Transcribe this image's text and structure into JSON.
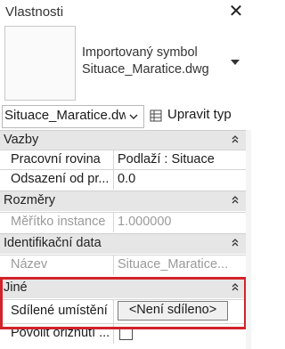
{
  "panel": {
    "title": "Vlastnosti"
  },
  "type_selector": {
    "name": "Importovaný symbol Situace_Maratice.dwg"
  },
  "instance_selector": {
    "value": "Situace_Maratice.dwg",
    "edit_type_label": "Upravit typ"
  },
  "groups": [
    {
      "label": "Vazby",
      "rows": [
        {
          "key": "Pracovní rovina",
          "value": "Podlaží : Situace"
        },
        {
          "key": "Odsazení od pr...",
          "value": "0.0"
        }
      ]
    },
    {
      "label": "Rozměry",
      "rows": [
        {
          "key": "Měřítko instance",
          "value": "1.000000"
        }
      ]
    },
    {
      "label": "Identifikační data",
      "rows": [
        {
          "key": "Název",
          "value": "Situace_Maratice..."
        }
      ]
    },
    {
      "label": "Jiné",
      "rows": [
        {
          "key": "Sdílené umístění",
          "value": "<Není sdíleno>"
        },
        {
          "key": "Povolit ořiznutí ...",
          "value": ""
        }
      ]
    }
  ],
  "colors": {
    "highlight": "#d2232a",
    "group_bg": "#e6e6e6"
  },
  "icons": {
    "close": "close-icon",
    "dropdown": "chevron-down-icon",
    "edit_type": "edit-type-icon",
    "collapse": "collapse-icon"
  }
}
